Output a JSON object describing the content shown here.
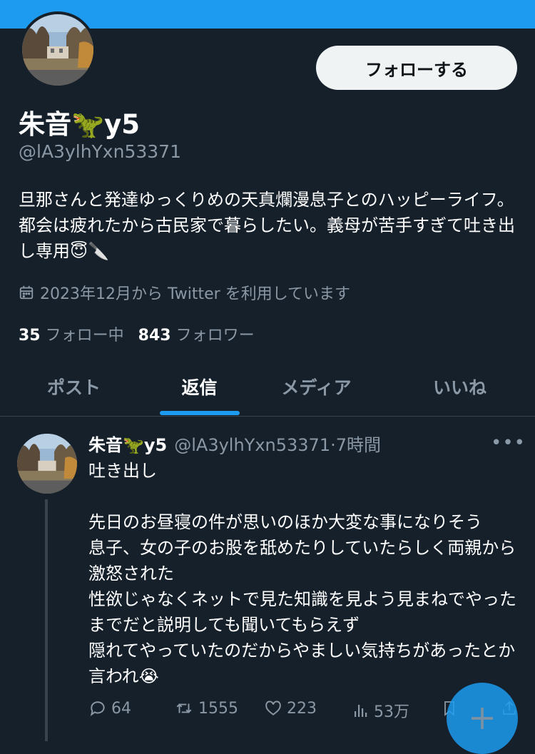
{
  "profile": {
    "name": "朱音🦖y5",
    "handle": "@lA3ylhYxn53371",
    "bio": "旦那さんと発達ゆっくりめの天真爛漫息子とのハッピーライフ。都会は疲れたから古民家で暮らしたい。義母が苦手すぎて吐き出し専用😇🔪",
    "joined": "2023年12月から Twitter を利用しています",
    "following_count": "35",
    "following_label": "フォロー中",
    "followers_count": "843",
    "followers_label": "フォロワー",
    "follow_button": "フォローする"
  },
  "tabs": [
    "ポスト",
    "返信",
    "メディア",
    "いいね"
  ],
  "active_tab": "返信",
  "post": {
    "name": "朱音🦖y5",
    "handle": "@lA3ylhYxn53371",
    "time": "7時間",
    "separator": "·",
    "more": "•••",
    "body": "吐き出し\n\n先日のお昼寝の件が思いのほか大変な事になりそう\n息子、女の子のお股を舐めたりしていたらしく両親から激怒された\n性欲じゃなくネットで見た知識を見よう見まねでやったまでだと説明しても聞いてもらえず\n隠れてやっていたのだからやましい気持ちがあったとか言われ😭",
    "replies": "64",
    "reposts": "1555",
    "likes": "223",
    "views": "53万"
  },
  "colors": {
    "background": "#15202b",
    "accent": "#1d9bf0",
    "muted": "#8b98a5",
    "divider": "#38444d"
  },
  "icons": [
    "calendar-icon",
    "reply-icon",
    "repost-icon",
    "like-icon",
    "views-icon",
    "bookmark-icon",
    "share-icon",
    "plus-icon",
    "more-icon"
  ]
}
